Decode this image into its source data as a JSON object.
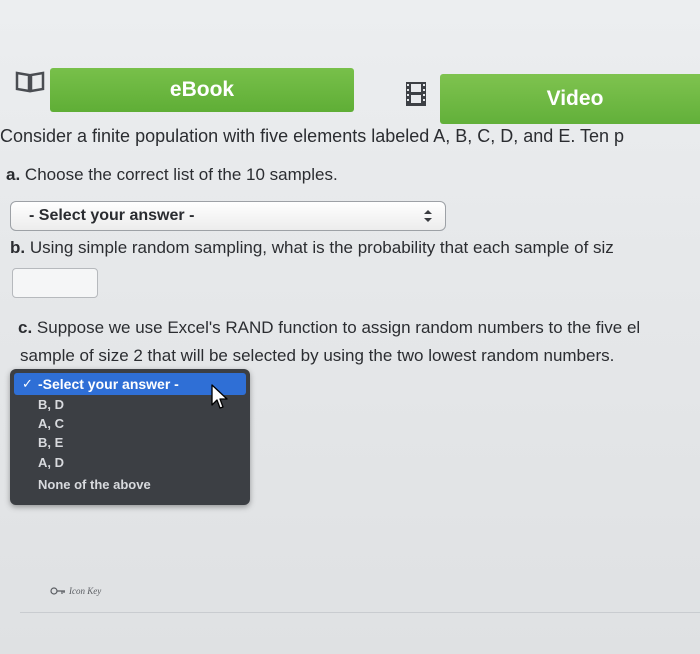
{
  "tabs": {
    "ebook_label": "eBook",
    "video_label": "Video"
  },
  "question": {
    "intro": "Consider a finite population with five elements labeled A, B, C, D, and E. Ten p",
    "part_a": {
      "label": "a.",
      "text": "Choose the correct list of the 10 samples.",
      "select_value": "- Select your answer -"
    },
    "part_b": {
      "label": "b.",
      "text": "Using simple random sampling, what is the probability that each sample of siz",
      "input_value": ""
    },
    "part_c": {
      "label": "c.",
      "text_line1": "Suppose we use Excel's RAND function to assign random numbers to the five el",
      "text_line2": "sample of size 2 that will be selected by using the two lowest random numbers."
    }
  },
  "dropdown": {
    "selected_label": "-Select your answer -",
    "options": [
      "B, D",
      "A, C",
      "B, E",
      "A, D",
      "None of the above"
    ]
  },
  "footer": {
    "icon_key_label": "Icon Key"
  },
  "colors": {
    "tab_green": "#6cb842",
    "menu_bg": "#3c3f44",
    "menu_highlight": "#2f6fd6"
  }
}
